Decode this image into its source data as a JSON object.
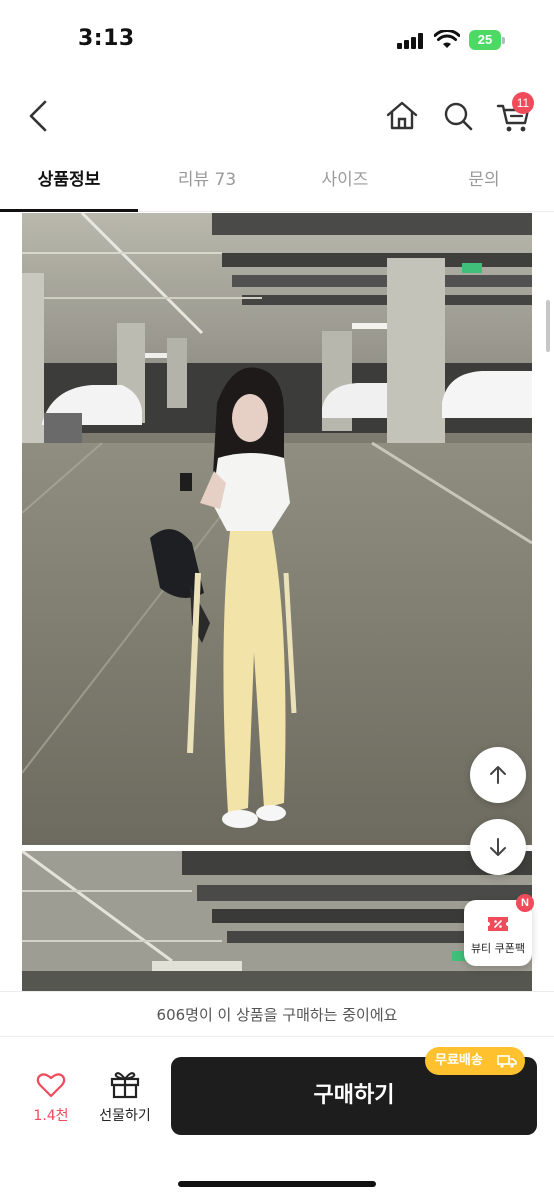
{
  "status_bar": {
    "time": "3:13",
    "battery": "25",
    "battery_color": "#4cd964"
  },
  "nav": {
    "back_icon": "chevron-left-icon",
    "home_icon": "home-icon",
    "search_icon": "search-icon",
    "cart_icon": "cart-icon",
    "cart_count": "11"
  },
  "tabs": [
    {
      "label": "상품정보",
      "active": true
    },
    {
      "label": "리뷰 73",
      "active": false
    },
    {
      "label": "사이즈",
      "active": false
    },
    {
      "label": "문의",
      "active": false
    }
  ],
  "floating": {
    "scroll_up_icon": "arrow-up-icon",
    "scroll_down_icon": "arrow-down-icon",
    "coupon_label": "뷰티 쿠폰팩",
    "coupon_badge": "N"
  },
  "buyers_banner": "606명이 이 상품을 구매하는 중이에요",
  "bottom_bar": {
    "like_icon": "heart-icon",
    "like_count": "1.4천",
    "gift_icon": "gift-icon",
    "gift_label": "선물하기",
    "buy_label": "구매하기",
    "shipping_badge": "무료배송",
    "shipping_icon": "truck-icon"
  },
  "colors": {
    "accent": "#ef4b5b",
    "buy_button": "#1d1d1d",
    "shipping_badge": "#ffc22e"
  }
}
